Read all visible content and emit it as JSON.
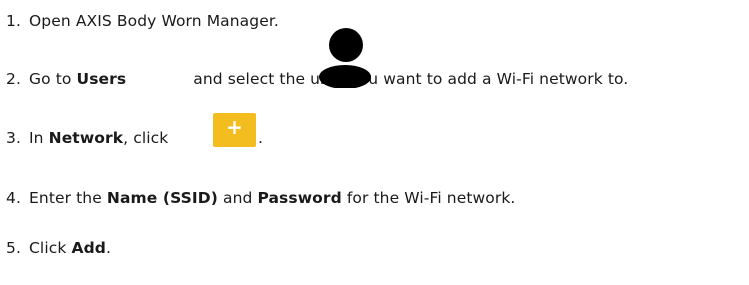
{
  "steps": [
    {
      "number": "1.",
      "parts": [
        "Open AXIS Body Worn Manager."
      ]
    },
    {
      "number": "2.",
      "go_to": "Go to ",
      "bold": "Users",
      "rest": " and select the user you want to add a Wi-Fi network to."
    },
    {
      "number": "3.",
      "prefix": "In ",
      "bold": "Network",
      "rest": ", click",
      "after": "."
    },
    {
      "number": "4.",
      "prefix": "Enter the ",
      "bold1": "Name (SSID)",
      "mid": " and ",
      "bold2": "Password",
      "rest": " for the Wi-Fi network."
    },
    {
      "number": "5.",
      "prefix": "Click ",
      "bold": "Add",
      "rest": "."
    }
  ],
  "icons": {
    "users_icon": "user-icon",
    "add_icon": "plus-icon",
    "add_icon_symbol": "+",
    "add_icon_color": "#f3bc1f"
  }
}
